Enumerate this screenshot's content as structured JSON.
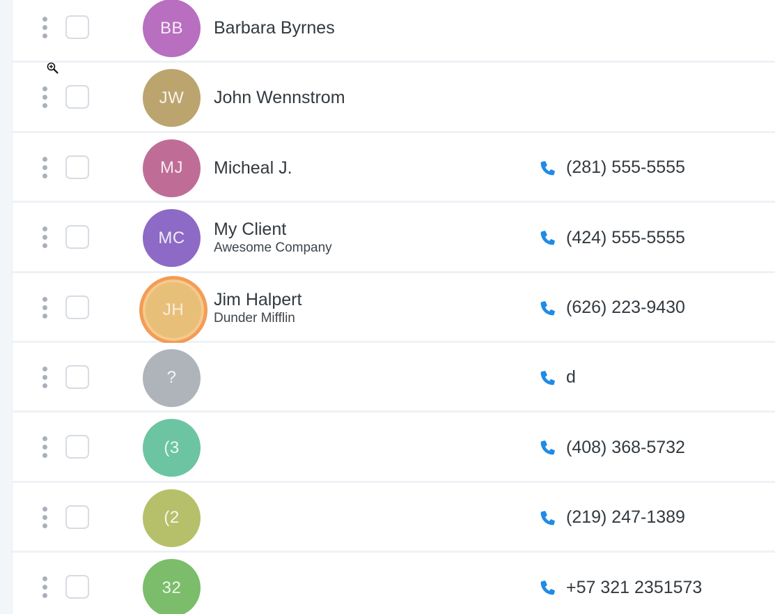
{
  "colors": {
    "phone_icon": "#1f8be6",
    "avatar_highlight_border": "#f39c57"
  },
  "contacts": [
    {
      "initials": "BB",
      "name": "Barbara Byrnes",
      "company": "",
      "phone": "",
      "avatar_color": "#b86fc0",
      "highlighted": false
    },
    {
      "initials": "JW",
      "name": "John Wennstrom",
      "company": "",
      "phone": "",
      "avatar_color": "#bca46f",
      "highlighted": false
    },
    {
      "initials": "MJ",
      "name": "Micheal J.",
      "company": "",
      "phone": "(281) 555-5555",
      "avatar_color": "#bf6d97",
      "highlighted": false
    },
    {
      "initials": "MC",
      "name": "My Client",
      "company": "Awesome Company",
      "phone": "(424) 555-5555",
      "avatar_color": "#8d6ac5",
      "highlighted": false
    },
    {
      "initials": "JH",
      "name": "Jim Halpert",
      "company": "Dunder Mifflin",
      "phone": "(626) 223-9430",
      "avatar_color": "#e7bf79",
      "highlighted": true
    },
    {
      "initials": "?",
      "name": "",
      "company": "",
      "phone": "d",
      "avatar_color": "#aeb4ba",
      "highlighted": false
    },
    {
      "initials": "(3",
      "name": "",
      "company": "",
      "phone": "(408) 368-5732",
      "avatar_color": "#6cc4a3",
      "highlighted": false
    },
    {
      "initials": "(2",
      "name": "",
      "company": "",
      "phone": "(219) 247-1389",
      "avatar_color": "#b6c06b",
      "highlighted": false
    },
    {
      "initials": "32",
      "name": "",
      "company": "",
      "phone": "+57 321 2351573",
      "avatar_color": "#7bbd6a",
      "highlighted": false
    }
  ]
}
